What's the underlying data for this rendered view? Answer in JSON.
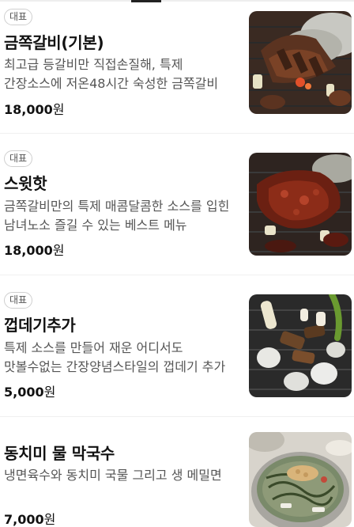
{
  "menu": [
    {
      "badge": "대표",
      "name": "금쪽갈비(기본)",
      "description": "최고급 등갈비만 직접손질해, 특제 간장소스에 저온48시간 숙성한 금쪽갈비",
      "price": "18,000",
      "currency": "원",
      "image_icon": "grilled-ribs-photo"
    },
    {
      "badge": "대표",
      "name": "스윗핫",
      "description": "금쪽갈비만의 특제 매콤달콤한 소스를 입힌 남녀노소 즐길 수 있는 베스트 메뉴",
      "price": "18,000",
      "currency": "원",
      "image_icon": "spicy-ribs-photo"
    },
    {
      "badge": "대표",
      "name": "껍데기추가",
      "description": "특제 소스를 만들어 재운 어디서도 맛볼수없는 간장양념스타일의 껍데기 추가",
      "price": "5,000",
      "currency": "원",
      "image_icon": "pork-skin-grill-photo"
    },
    {
      "badge": "",
      "name": "동치미 물 막국수",
      "description": "냉면육수와 동치미 국물 그리고 생 메밀면",
      "price": "7,000",
      "currency": "원",
      "image_icon": "buckwheat-noodle-photo"
    }
  ]
}
